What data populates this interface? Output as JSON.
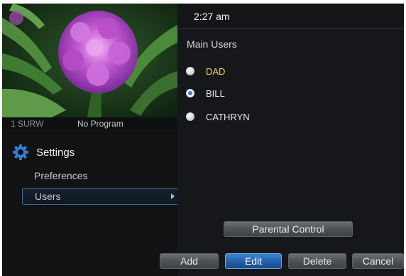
{
  "clock": "2:27 am",
  "channel": {
    "number": "1  SURW",
    "program": "No Program"
  },
  "settings": {
    "title": "Settings"
  },
  "menu": {
    "items": [
      {
        "label": "Preferences"
      },
      {
        "label": "Users"
      }
    ],
    "selected_index": 1
  },
  "main_users": {
    "title": "Main Users",
    "users": [
      {
        "label": "DAD",
        "selected": false,
        "highlighted": true
      },
      {
        "label": "BILL",
        "selected": true,
        "highlighted": false
      },
      {
        "label": "CATHRYN",
        "selected": false,
        "highlighted": false
      }
    ]
  },
  "buttons": {
    "parental_control": "Parental Control",
    "add": "Add",
    "edit": "Edit",
    "delete": "Delete",
    "cancel": "Cancel"
  },
  "colors": {
    "highlight_text": "#f1d84b",
    "accent_blue": "#2f78c4",
    "background": "#111214"
  },
  "icons": {
    "settings": "gear-icon",
    "menu_arrow": "chevron-right-icon"
  }
}
